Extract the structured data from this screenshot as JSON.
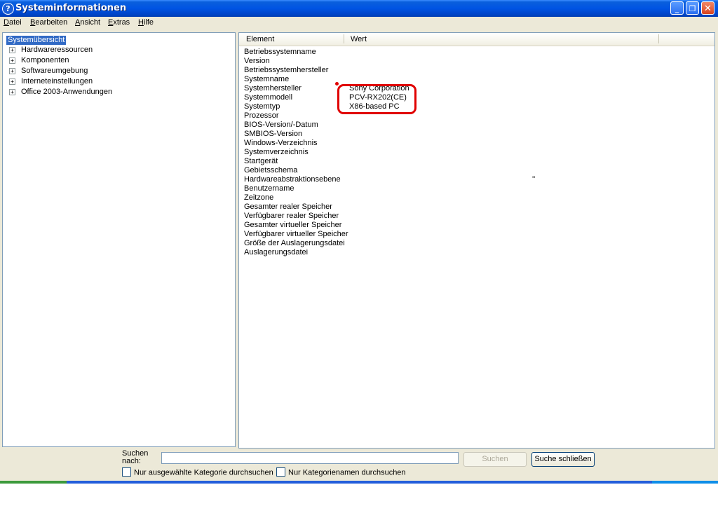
{
  "window": {
    "title": "Systeminformationen",
    "app_icon_glyph": "?",
    "minimize_glyph": "_",
    "maximize_glyph": "❐",
    "close_glyph": "✕"
  },
  "menu": [
    {
      "accel": "D",
      "rest": "atei"
    },
    {
      "accel": "B",
      "rest": "earbeiten"
    },
    {
      "accel": "A",
      "rest": "nsicht"
    },
    {
      "accel": "E",
      "rest": "xtras"
    },
    {
      "accel": "H",
      "rest": "ilfe"
    }
  ],
  "tree": {
    "root": "Systemübersicht",
    "expander_glyph": "+",
    "children": [
      "Hardwareressourcen",
      "Komponenten",
      "Softwareumgebung",
      "Interneteinstellungen",
      "Office 2003-Anwendungen"
    ]
  },
  "list": {
    "columns": [
      "Element",
      "Wert"
    ],
    "rows": [
      {
        "element": "Betriebssystemname",
        "value": ""
      },
      {
        "element": "Version",
        "value": ""
      },
      {
        "element": "Betriebssystemhersteller",
        "value": ""
      },
      {
        "element": "Systemname",
        "value": ""
      },
      {
        "element": "Systemhersteller",
        "value": "Sony Corporation"
      },
      {
        "element": "Systemmodell",
        "value": "PCV-RX202(CE)"
      },
      {
        "element": "Systemtyp",
        "value": "X86-based PC"
      },
      {
        "element": "Prozessor",
        "value": ""
      },
      {
        "element": "BIOS-Version/-Datum",
        "value": ""
      },
      {
        "element": "SMBIOS-Version",
        "value": ""
      },
      {
        "element": "Windows-Verzeichnis",
        "value": ""
      },
      {
        "element": "Systemverzeichnis",
        "value": ""
      },
      {
        "element": "Startgerät",
        "value": ""
      },
      {
        "element": "Gebietsschema",
        "value": ""
      },
      {
        "element": "Hardwareabstraktionsebene",
        "value": ""
      },
      {
        "element": "Benutzername",
        "value": ""
      },
      {
        "element": "Zeitzone",
        "value": ""
      },
      {
        "element": "Gesamter realer Speicher",
        "value": ""
      },
      {
        "element": "Verfügbarer realer Speicher",
        "value": ""
      },
      {
        "element": "Gesamter virtueller Speicher",
        "value": ""
      },
      {
        "element": "Verfügbarer virtueller Speicher",
        "value": ""
      },
      {
        "element": "Größe der Auslagerungsdatei",
        "value": ""
      },
      {
        "element": "Auslagerungsdatei",
        "value": ""
      }
    ],
    "stray_mark": "''"
  },
  "search": {
    "label_line1": "Suchen",
    "label_line2": "nach:",
    "value": "",
    "search_button": "Suchen",
    "close_button": "Suche schließen",
    "checkbox1": "Nur ausgewählte Kategorie durchsuchen",
    "checkbox2": "Nur Kategorienamen durchsuchen"
  },
  "colors": {
    "titlebar": "#0054e3",
    "selection": "#316ac5",
    "highlight_annotation": "#e00000",
    "face": "#ece9d8"
  }
}
